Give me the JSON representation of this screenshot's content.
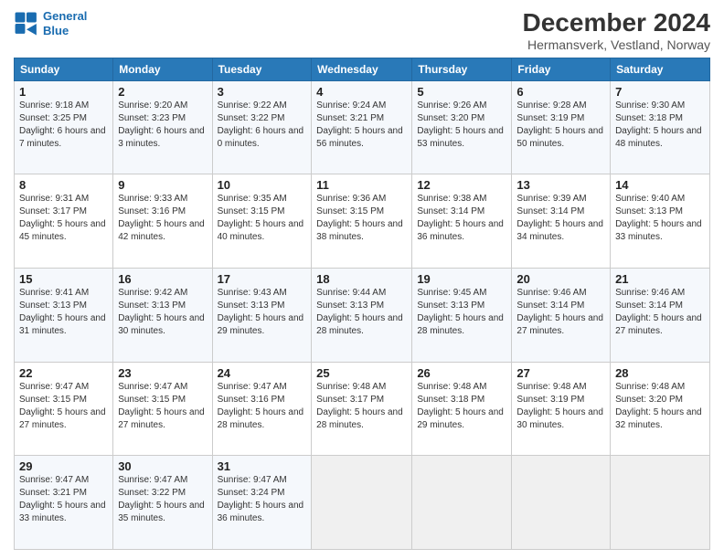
{
  "logo": {
    "line1": "General",
    "line2": "Blue"
  },
  "title": "December 2024",
  "subtitle": "Hermansverk, Vestland, Norway",
  "days_of_week": [
    "Sunday",
    "Monday",
    "Tuesday",
    "Wednesday",
    "Thursday",
    "Friday",
    "Saturday"
  ],
  "weeks": [
    [
      {
        "day": "1",
        "sunrise": "9:18 AM",
        "sunset": "3:25 PM",
        "daylight": "6 hours and 7 minutes."
      },
      {
        "day": "2",
        "sunrise": "9:20 AM",
        "sunset": "3:23 PM",
        "daylight": "6 hours and 3 minutes."
      },
      {
        "day": "3",
        "sunrise": "9:22 AM",
        "sunset": "3:22 PM",
        "daylight": "6 hours and 0 minutes."
      },
      {
        "day": "4",
        "sunrise": "9:24 AM",
        "sunset": "3:21 PM",
        "daylight": "5 hours and 56 minutes."
      },
      {
        "day": "5",
        "sunrise": "9:26 AM",
        "sunset": "3:20 PM",
        "daylight": "5 hours and 53 minutes."
      },
      {
        "day": "6",
        "sunrise": "9:28 AM",
        "sunset": "3:19 PM",
        "daylight": "5 hours and 50 minutes."
      },
      {
        "day": "7",
        "sunrise": "9:30 AM",
        "sunset": "3:18 PM",
        "daylight": "5 hours and 48 minutes."
      }
    ],
    [
      {
        "day": "8",
        "sunrise": "9:31 AM",
        "sunset": "3:17 PM",
        "daylight": "5 hours and 45 minutes."
      },
      {
        "day": "9",
        "sunrise": "9:33 AM",
        "sunset": "3:16 PM",
        "daylight": "5 hours and 42 minutes."
      },
      {
        "day": "10",
        "sunrise": "9:35 AM",
        "sunset": "3:15 PM",
        "daylight": "5 hours and 40 minutes."
      },
      {
        "day": "11",
        "sunrise": "9:36 AM",
        "sunset": "3:15 PM",
        "daylight": "5 hours and 38 minutes."
      },
      {
        "day": "12",
        "sunrise": "9:38 AM",
        "sunset": "3:14 PM",
        "daylight": "5 hours and 36 minutes."
      },
      {
        "day": "13",
        "sunrise": "9:39 AM",
        "sunset": "3:14 PM",
        "daylight": "5 hours and 34 minutes."
      },
      {
        "day": "14",
        "sunrise": "9:40 AM",
        "sunset": "3:13 PM",
        "daylight": "5 hours and 33 minutes."
      }
    ],
    [
      {
        "day": "15",
        "sunrise": "9:41 AM",
        "sunset": "3:13 PM",
        "daylight": "5 hours and 31 minutes."
      },
      {
        "day": "16",
        "sunrise": "9:42 AM",
        "sunset": "3:13 PM",
        "daylight": "5 hours and 30 minutes."
      },
      {
        "day": "17",
        "sunrise": "9:43 AM",
        "sunset": "3:13 PM",
        "daylight": "5 hours and 29 minutes."
      },
      {
        "day": "18",
        "sunrise": "9:44 AM",
        "sunset": "3:13 PM",
        "daylight": "5 hours and 28 minutes."
      },
      {
        "day": "19",
        "sunrise": "9:45 AM",
        "sunset": "3:13 PM",
        "daylight": "5 hours and 28 minutes."
      },
      {
        "day": "20",
        "sunrise": "9:46 AM",
        "sunset": "3:14 PM",
        "daylight": "5 hours and 27 minutes."
      },
      {
        "day": "21",
        "sunrise": "9:46 AM",
        "sunset": "3:14 PM",
        "daylight": "5 hours and 27 minutes."
      }
    ],
    [
      {
        "day": "22",
        "sunrise": "9:47 AM",
        "sunset": "3:15 PM",
        "daylight": "5 hours and 27 minutes."
      },
      {
        "day": "23",
        "sunrise": "9:47 AM",
        "sunset": "3:15 PM",
        "daylight": "5 hours and 27 minutes."
      },
      {
        "day": "24",
        "sunrise": "9:47 AM",
        "sunset": "3:16 PM",
        "daylight": "5 hours and 28 minutes."
      },
      {
        "day": "25",
        "sunrise": "9:48 AM",
        "sunset": "3:17 PM",
        "daylight": "5 hours and 28 minutes."
      },
      {
        "day": "26",
        "sunrise": "9:48 AM",
        "sunset": "3:18 PM",
        "daylight": "5 hours and 29 minutes."
      },
      {
        "day": "27",
        "sunrise": "9:48 AM",
        "sunset": "3:19 PM",
        "daylight": "5 hours and 30 minutes."
      },
      {
        "day": "28",
        "sunrise": "9:48 AM",
        "sunset": "3:20 PM",
        "daylight": "5 hours and 32 minutes."
      }
    ],
    [
      {
        "day": "29",
        "sunrise": "9:47 AM",
        "sunset": "3:21 PM",
        "daylight": "5 hours and 33 minutes."
      },
      {
        "day": "30",
        "sunrise": "9:47 AM",
        "sunset": "3:22 PM",
        "daylight": "5 hours and 35 minutes."
      },
      {
        "day": "31",
        "sunrise": "9:47 AM",
        "sunset": "3:24 PM",
        "daylight": "5 hours and 36 minutes."
      },
      null,
      null,
      null,
      null
    ]
  ]
}
